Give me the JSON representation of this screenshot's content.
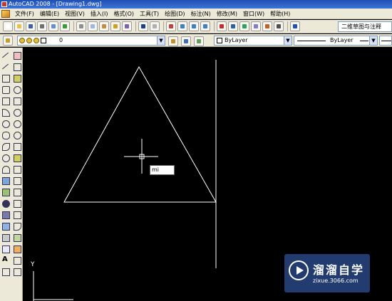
{
  "window": {
    "title": "AutoCAD 2008 - [Drawing1.dwg]"
  },
  "menu": {
    "items": [
      {
        "label": "文件(F)",
        "id": "file"
      },
      {
        "label": "编辑(E)",
        "id": "edit"
      },
      {
        "label": "视图(V)",
        "id": "view"
      },
      {
        "label": "插入(I)",
        "id": "insert"
      },
      {
        "label": "格式(O)",
        "id": "format"
      },
      {
        "label": "工具(T)",
        "id": "tools"
      },
      {
        "label": "绘图(D)",
        "id": "draw"
      },
      {
        "label": "标注(N)",
        "id": "dimension"
      },
      {
        "label": "修改(M)",
        "id": "modify"
      },
      {
        "label": "窗口(W)",
        "id": "window"
      },
      {
        "label": "帮助(H)",
        "id": "help"
      }
    ]
  },
  "toolbar": {
    "workspace": "二维草图与注释"
  },
  "properties": {
    "layer": "0",
    "color": "ByLayer",
    "linetype": "ByLayer"
  },
  "command": {
    "input_value": "mi"
  },
  "ucs": {
    "y_label": "Y"
  },
  "watermark": {
    "title": "溜溜自学",
    "url": "zixue.3066.com"
  },
  "colors": {
    "canvas": "#000000",
    "geometry": "#ffffff",
    "titlebar": "#2a5cc4",
    "chrome": "#ece9d8"
  }
}
